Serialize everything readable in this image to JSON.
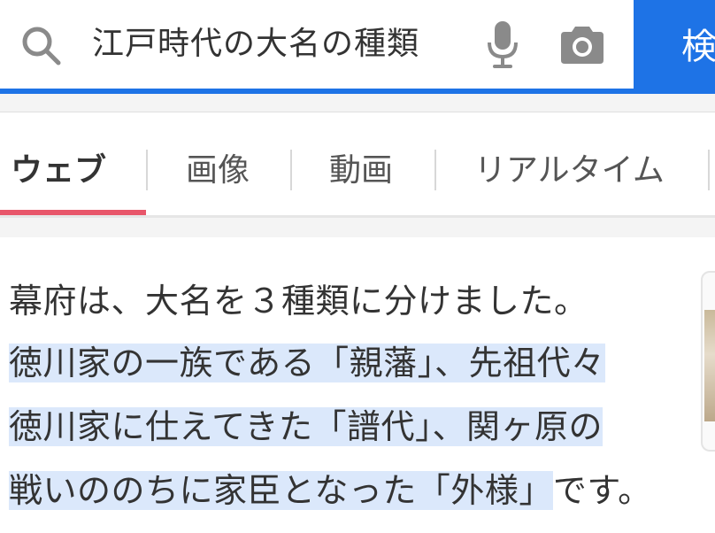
{
  "search": {
    "query": "江戸時代の大名の種類",
    "button_label": "検索"
  },
  "tabs": [
    {
      "label": "ウェブ",
      "active": true
    },
    {
      "label": "画像",
      "active": false
    },
    {
      "label": "動画",
      "active": false
    },
    {
      "label": "リアルタイム",
      "active": false
    }
  ],
  "answer": {
    "lines": [
      {
        "plain": "幕府は、大名を３種類に分けました。",
        "highlight": ""
      },
      {
        "plain": "",
        "highlight": "徳川家の一族である「親藩」、先祖代々"
      },
      {
        "plain": "",
        "highlight": "徳川家に仕えてきた「譜代」、関ヶ原の"
      },
      {
        "plain": "です。",
        "highlight": "戦いののちに家臣となった「外様」"
      }
    ]
  },
  "icons": {
    "search": "search-icon",
    "mic": "mic-icon",
    "camera": "camera-icon"
  },
  "colors": {
    "accent": "#1e73e6",
    "tab_underline": "#e8566a",
    "highlight": "#dbe8fb"
  }
}
